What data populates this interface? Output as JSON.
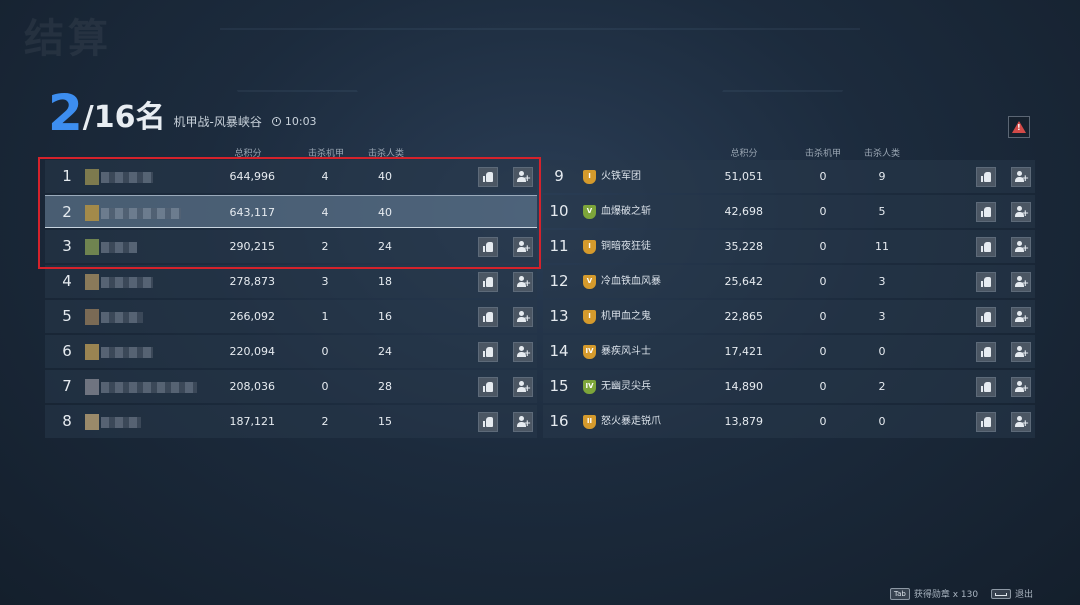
{
  "background_title": "结算",
  "header": {
    "rank": "2",
    "rank_total": "/16名",
    "mode": "机甲战-风暴峡谷",
    "time": "10:03"
  },
  "columns": {
    "score": "总积分",
    "mech_kills": "击杀机甲",
    "human_kills": "击杀人类"
  },
  "left_players": [
    {
      "rank": "1",
      "score": "644,996",
      "mech_kills": "4",
      "human_kills": "40",
      "self": false,
      "show_buttons": true,
      "avatar_color": "#7d7a4e"
    },
    {
      "rank": "2",
      "score": "643,117",
      "mech_kills": "4",
      "human_kills": "40",
      "self": true,
      "show_buttons": false,
      "avatar_color": "#a38a4a"
    },
    {
      "rank": "3",
      "score": "290,215",
      "mech_kills": "2",
      "human_kills": "24",
      "self": false,
      "show_buttons": true,
      "avatar_color": "#6f8450"
    },
    {
      "rank": "4",
      "score": "278,873",
      "mech_kills": "3",
      "human_kills": "18",
      "self": false,
      "show_buttons": true,
      "avatar_color": "#8a7a5a"
    },
    {
      "rank": "5",
      "score": "266,092",
      "mech_kills": "1",
      "human_kills": "16",
      "self": false,
      "show_buttons": true,
      "avatar_color": "#7a6a55"
    },
    {
      "rank": "6",
      "score": "220,094",
      "mech_kills": "0",
      "human_kills": "24",
      "self": false,
      "show_buttons": true,
      "avatar_color": "#9a8452"
    },
    {
      "rank": "7",
      "score": "208,036",
      "mech_kills": "0",
      "human_kills": "28",
      "self": false,
      "show_buttons": true,
      "avatar_color": "#6f7480"
    },
    {
      "rank": "8",
      "score": "187,121",
      "mech_kills": "2",
      "human_kills": "15",
      "self": false,
      "show_buttons": true,
      "avatar_color": "#9a8a6a"
    }
  ],
  "right_teams": [
    {
      "rank": "9",
      "name": "火铁军团",
      "score": "51,051",
      "mech_kills": "0",
      "human_kills": "9",
      "badge": "I",
      "badge_color": "gold"
    },
    {
      "rank": "10",
      "name": "血爆破之斩",
      "score": "42,698",
      "mech_kills": "0",
      "human_kills": "5",
      "badge": "V",
      "badge_color": "green"
    },
    {
      "rank": "11",
      "name": "铜暗夜狂徒",
      "score": "35,228",
      "mech_kills": "0",
      "human_kills": "11",
      "badge": "I",
      "badge_color": "gold"
    },
    {
      "rank": "12",
      "name": "冷血铁血风暴",
      "score": "25,642",
      "mech_kills": "0",
      "human_kills": "3",
      "badge": "V",
      "badge_color": "gold"
    },
    {
      "rank": "13",
      "name": "机甲血之鬼",
      "score": "22,865",
      "mech_kills": "0",
      "human_kills": "3",
      "badge": "I",
      "badge_color": "gold"
    },
    {
      "rank": "14",
      "name": "暴疾风斗士",
      "score": "17,421",
      "mech_kills": "0",
      "human_kills": "0",
      "badge": "IV",
      "badge_color": "gold"
    },
    {
      "rank": "15",
      "name": "无幽灵尖兵",
      "score": "14,890",
      "mech_kills": "0",
      "human_kills": "2",
      "badge": "IV",
      "badge_color": "green"
    },
    {
      "rank": "16",
      "name": "怒火暴走锐爪",
      "score": "13,879",
      "mech_kills": "0",
      "human_kills": "0",
      "badge": "II",
      "badge_color": "gold"
    }
  ],
  "footer": {
    "tab_key": "Tab",
    "medals": "获得勋章 x 130",
    "exit": "退出"
  },
  "icons": {
    "report": "warning-triangle-icon",
    "like": "thumbs-up-icon",
    "add_friend": "add-friend-icon",
    "clock": "clock-icon"
  },
  "colors": {
    "rank_accent": "#3d8ef0",
    "highlight_border": "#d5222b",
    "report": "#d24a48"
  }
}
